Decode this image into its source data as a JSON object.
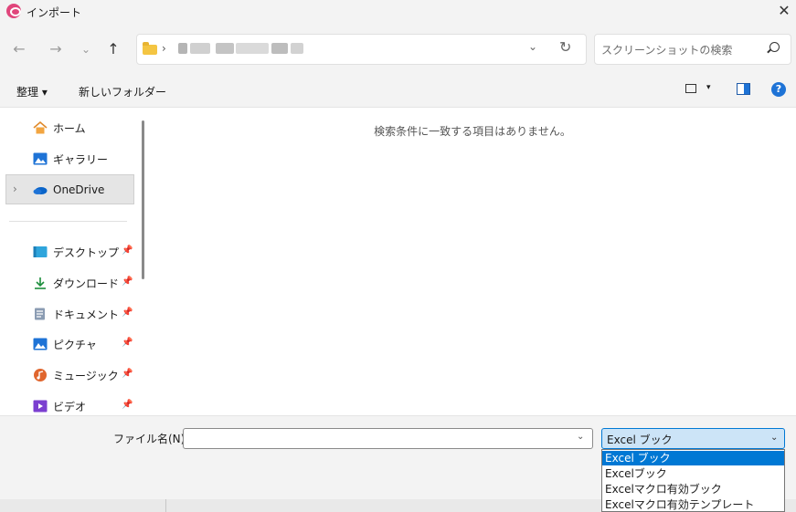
{
  "window": {
    "title": "インポート",
    "close_icon": "close-icon"
  },
  "address": {
    "breadcrumb_separator": "›",
    "dropdown_glyph": "⌄",
    "refresh_glyph": "↻"
  },
  "nav_buttons": {
    "back": "←",
    "forward": "→",
    "recent": "⌄",
    "up": "↑"
  },
  "search": {
    "placeholder": "スクリーンショットの検索"
  },
  "toolbar": {
    "organize_label": "整理 ▾",
    "new_folder_label": "新しいフォルダー",
    "view_arrow": "▾",
    "help_glyph": "?"
  },
  "sidebar": {
    "items": [
      {
        "label": "ホーム",
        "icon": "home-icon"
      },
      {
        "label": "ギャラリー",
        "icon": "gallery-icon"
      },
      {
        "label": "OneDrive",
        "icon": "cloud-icon",
        "expand_glyph": "›"
      },
      {
        "label": "デスクトップ",
        "icon": "desktop-icon",
        "pinned": true
      },
      {
        "label": "ダウンロード",
        "icon": "download-icon",
        "pinned": true
      },
      {
        "label": "ドキュメント",
        "icon": "document-icon",
        "pinned": true
      },
      {
        "label": "ピクチャ",
        "icon": "pictures-icon",
        "pinned": true
      },
      {
        "label": "ミュージック",
        "icon": "music-icon",
        "pinned": true
      },
      {
        "label": "ビデオ",
        "icon": "video-icon",
        "pinned": true
      }
    ],
    "pin_glyph": "📌"
  },
  "content": {
    "empty_message": "検索条件に一致する項目はありません。"
  },
  "footer": {
    "filename_label": "ファイル名(N):",
    "filename_value": "",
    "filetype_selected": "Excel ブック",
    "filetype_options": [
      "Excel ブック",
      "Excelブック",
      "Excelマクロ有効ブック",
      "Excelマクロ有効テンプレート"
    ],
    "dropdown_glyph": "⌄"
  },
  "colors": {
    "accent": "#0078d4",
    "app_icon": "#e0457b",
    "folder": "#f4c542"
  }
}
